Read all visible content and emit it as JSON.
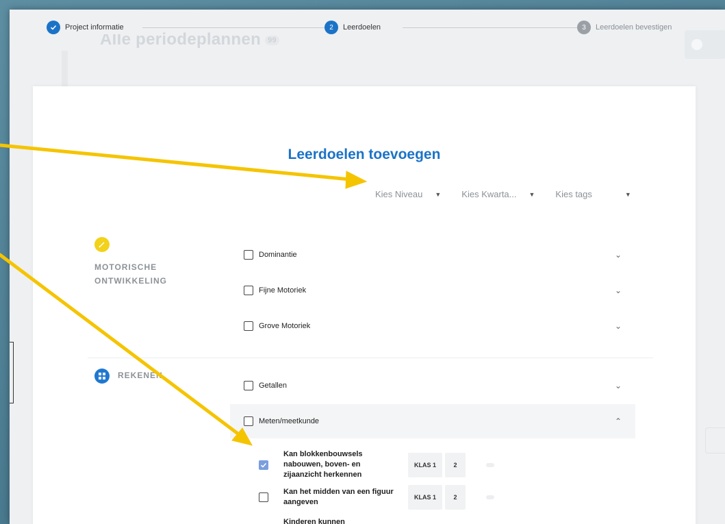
{
  "stepper": {
    "steps": [
      {
        "label": "Project informatie",
        "marker": "check-icon",
        "state": "done"
      },
      {
        "label": "Leerdoelen",
        "marker": "2",
        "state": "active"
      },
      {
        "label": "Leerdoelen bevestigen",
        "marker": "3",
        "state": "todo"
      }
    ]
  },
  "background": {
    "page_title": "Alle periodeplannen",
    "title_count": "99"
  },
  "modal": {
    "title": "Leerdoelen toevoegen",
    "filters": [
      {
        "label": "Kies Niveau"
      },
      {
        "label": "Kies Kwarta..."
      },
      {
        "label": "Kies tags"
      }
    ]
  },
  "categories": [
    {
      "name_line1": "MOTORISCHE",
      "name_line2": "ONTWIKKELING",
      "icon": "pencil-icon",
      "icon_color": "#f2d21a",
      "items": [
        {
          "label": "Dominantie",
          "checked": false,
          "expanded": false
        },
        {
          "label": "Fijne Motoriek",
          "checked": false,
          "expanded": false
        },
        {
          "label": "Grove Motoriek",
          "checked": false,
          "expanded": false
        }
      ]
    },
    {
      "name_line1": "REKENEN",
      "icon": "grid-icon",
      "icon_color": "#1f78d0",
      "items": [
        {
          "label": "Getallen",
          "checked": false,
          "expanded": false
        },
        {
          "label": "Meten/meetkunde",
          "checked": false,
          "expanded": true
        }
      ]
    }
  ],
  "goals": [
    {
      "text": "Kan blokkenbouwsels nabouwen, boven- en zijaanzicht herkennen",
      "klas": "KLAS 1",
      "number": "2",
      "checked": true
    },
    {
      "text": "Kan het midden van een figuur aangeven",
      "klas": "KLAS 1",
      "number": "2",
      "checked": false
    },
    {
      "text": "Kinderen kunnen",
      "checked": false
    }
  ],
  "colors": {
    "accent": "#1b73c7",
    "annotation_arrow": "#f5c400",
    "checkbox_checked": "#7a9ede"
  }
}
